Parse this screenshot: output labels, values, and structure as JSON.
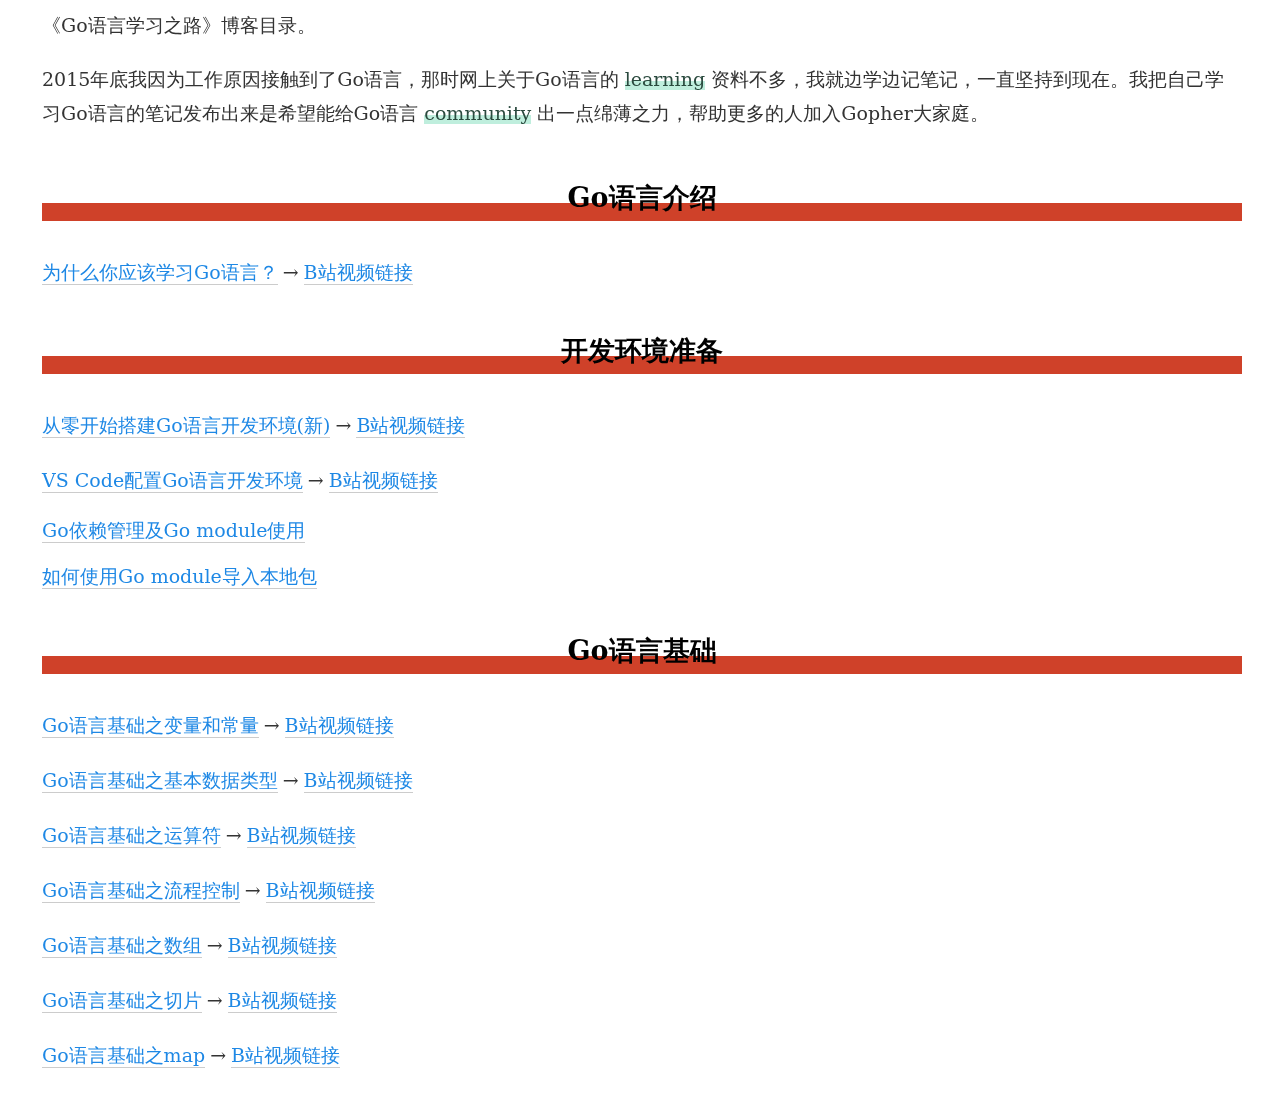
{
  "intro": "《Go语言学习之路》博客目录。",
  "paragraph": [
    {
      "text": "2015年底我因为工作原因接触到了Go语言，那时网上关于Go语言的 ",
      "highlight": false
    },
    {
      "text": "learning",
      "highlight": true
    },
    {
      "text": " 资料不多，我就边学边记笔记，一直坚持到现在。我把自己学习Go语言的笔记发布出来是希望能给Go语言 ",
      "highlight": false
    },
    {
      "text": "community",
      "highlight": true
    },
    {
      "text": " 出一点绵薄之力，帮助更多的人加入Gopher大家庭。",
      "highlight": false
    }
  ],
  "sections": [
    {
      "heading": "Go语言介绍",
      "items": [
        {
          "title": "为什么你应该学习Go语言？",
          "arrow": "→",
          "video": "B站视频链接"
        }
      ]
    },
    {
      "heading": "开发环境准备",
      "items": [
        {
          "title": "从零开始搭建Go语言开发环境(新)",
          "arrow": "→",
          "video": "B站视频链接"
        },
        {
          "title": "VS Code配置Go语言开发环境",
          "arrow": "→",
          "video": "B站视频链接"
        },
        {
          "title": "Go依赖管理及Go module使用"
        },
        {
          "title": "如何使用Go module导入本地包"
        }
      ]
    },
    {
      "heading": "Go语言基础",
      "items": [
        {
          "title": "Go语言基础之变量和常量",
          "arrow": "→",
          "video": "B站视频链接"
        },
        {
          "title": "Go语言基础之基本数据类型",
          "arrow": "→",
          "video": "B站视频链接"
        },
        {
          "title": "Go语言基础之运算符",
          "arrow": "→",
          "video": "B站视频链接"
        },
        {
          "title": "Go语言基础之流程控制",
          "arrow": "→",
          "video": "B站视频链接"
        },
        {
          "title": "Go语言基础之数组",
          "arrow": "→",
          "video": "B站视频链接"
        },
        {
          "title": "Go语言基础之切片",
          "arrow": "→",
          "video": "B站视频链接"
        },
        {
          "title": "Go语言基础之map",
          "arrow": "→",
          "video": "B站视频链接"
        }
      ]
    }
  ]
}
